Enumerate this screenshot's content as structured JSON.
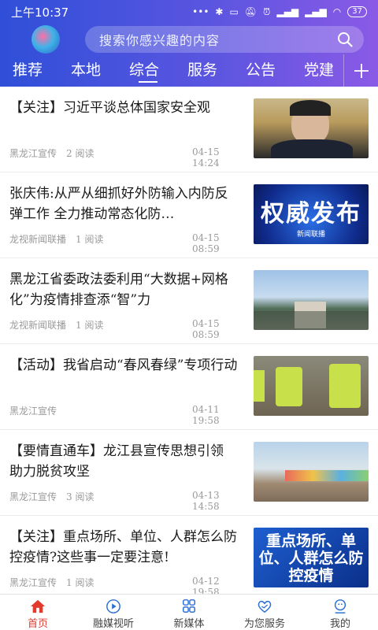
{
  "status": {
    "time": "上午10:37",
    "battery": "37"
  },
  "search": {
    "placeholder": "搜索你感兴趣的内容"
  },
  "tabs": [
    {
      "label": "推荐"
    },
    {
      "label": "本地"
    },
    {
      "label": "综合"
    },
    {
      "label": "服务"
    },
    {
      "label": "公告"
    },
    {
      "label": "党建"
    }
  ],
  "feed": [
    {
      "title": "【关注】习近平谈总体国家安全观",
      "source": "黑龙江宣传",
      "reads": "2 阅读",
      "time": "04-15 14:24"
    },
    {
      "title": "张庆伟:从严从细抓好外防输入内防反弹工作 全力推动常态化防…",
      "source": "龙视新闻联播",
      "reads": "1 阅读",
      "time": "04-15 08:59",
      "thumb_text": "权威发布",
      "thumb_sub": "新闻联播"
    },
    {
      "title": "黑龙江省委政法委利用“大数据+网格化”为疫情排查添“智”力",
      "source": "龙视新闻联播",
      "reads": "1 阅读",
      "time": "04-15 08:59"
    },
    {
      "title": "【活动】我省启动“春风春绿”专项行动",
      "source": "黑龙江宣传",
      "reads": "",
      "time": "04-11 19:58"
    },
    {
      "title": "【要情直通车】龙江县宣传思想引领 助力脱贫攻坚",
      "source": "黑龙江宣传",
      "reads": "3 阅读",
      "time": "04-13 14:58"
    },
    {
      "title": "【关注】重点场所、单位、人群怎么防控疫情?这些事一定要注意!",
      "source": "黑龙江宣传",
      "reads": "1 阅读",
      "time": "04-12 19:58",
      "thumb_text": "重点场所、单位、人群怎么防控疫情"
    }
  ],
  "bottom_nav": [
    {
      "label": "首页",
      "icon": "home-icon"
    },
    {
      "label": "融媒视听",
      "icon": "play-icon"
    },
    {
      "label": "新媒体",
      "icon": "grid-icon"
    },
    {
      "label": "为您服务",
      "icon": "handshake-icon"
    },
    {
      "label": "我的",
      "icon": "user-icon"
    }
  ],
  "colors": {
    "header_start": "#2f4fd8",
    "header_end": "#8a5ae6",
    "active_nav": "#e23b2e"
  }
}
